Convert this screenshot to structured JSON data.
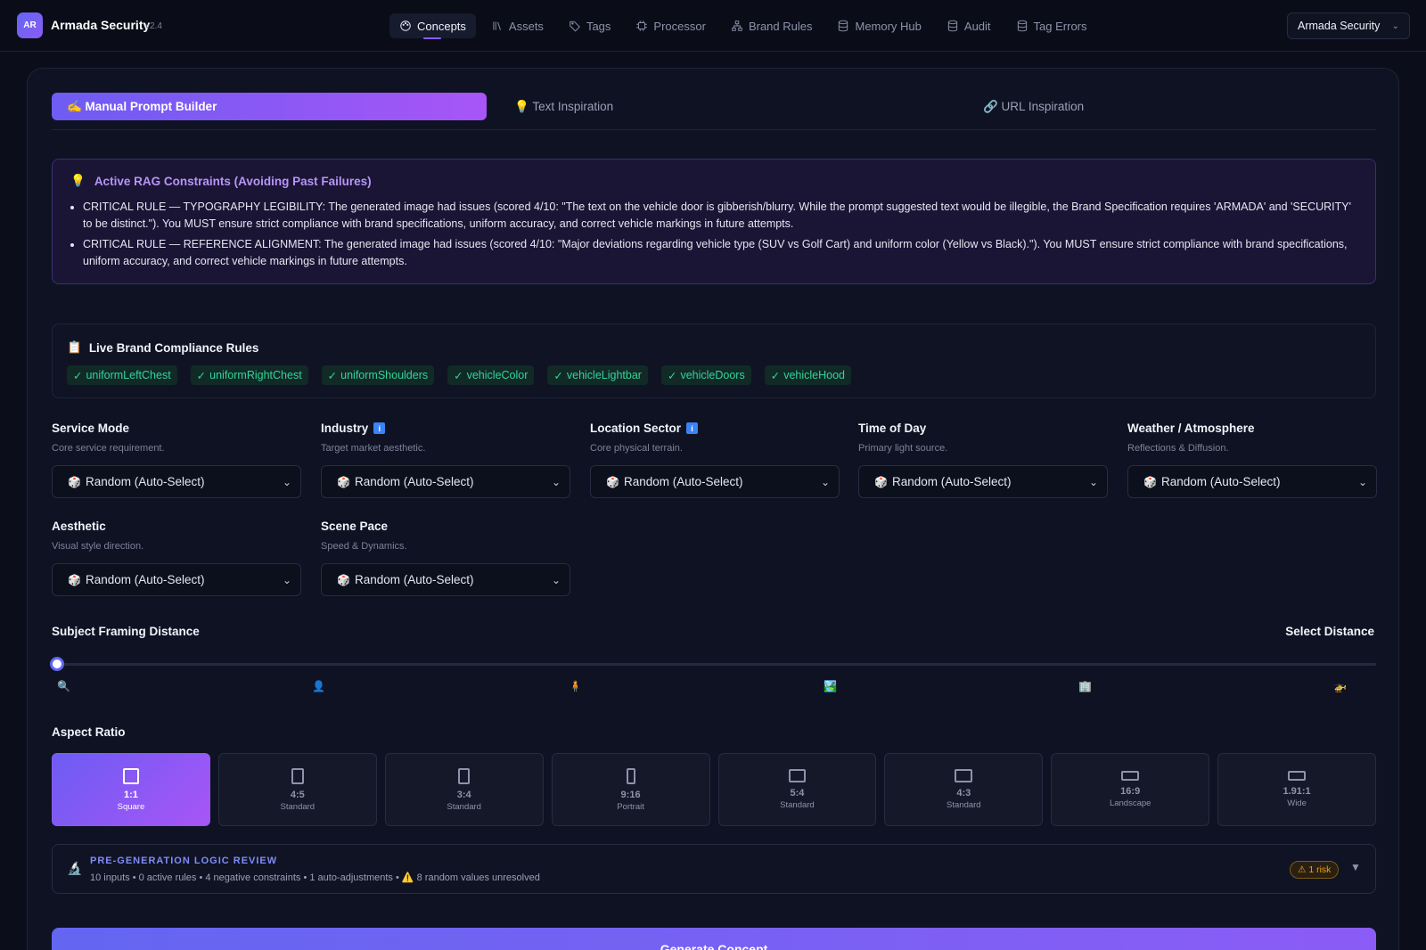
{
  "app": {
    "badge": "AR",
    "title": "Armada Security",
    "version": "v2.4"
  },
  "nav": [
    {
      "label": "Concepts",
      "icon": "palette-icon",
      "active": true
    },
    {
      "label": "Assets",
      "icon": "library-icon",
      "active": false
    },
    {
      "label": "Tags",
      "icon": "tag-icon",
      "active": false
    },
    {
      "label": "Processor",
      "icon": "cpu-icon",
      "active": false
    },
    {
      "label": "Brand Rules",
      "icon": "sitemap-icon",
      "active": false
    },
    {
      "label": "Memory Hub",
      "icon": "database-icon",
      "active": false
    },
    {
      "label": "Audit",
      "icon": "database-icon",
      "active": false
    },
    {
      "label": "Tag Errors",
      "icon": "database-icon",
      "active": false
    }
  ],
  "org_select": {
    "value": "Armada Security"
  },
  "mode_tabs": [
    {
      "label": "✍️ Manual Prompt Builder",
      "active": true
    },
    {
      "label": "💡 Text Inspiration",
      "active": false
    },
    {
      "label": "🔗 URL Inspiration",
      "active": false
    }
  ],
  "rag": {
    "title": "Active RAG Constraints (Avoiding Past Failures)",
    "rules": [
      "CRITICAL RULE — TYPOGRAPHY LEGIBILITY: The generated image had issues (scored 4/10: \"The text on the vehicle door is gibberish/blurry. While the prompt suggested text would be illegible, the Brand Specification requires 'ARMADA' and 'SECURITY' to be distinct.\"). You MUST ensure strict compliance with brand specifications, uniform accuracy, and correct vehicle markings in future attempts.",
      "CRITICAL RULE — REFERENCE ALIGNMENT: The generated image had issues (scored 4/10: \"Major deviations regarding vehicle type (SUV vs Golf Cart) and uniform color (Yellow vs Black).\"). You MUST ensure strict compliance with brand specifications, uniform accuracy, and correct vehicle markings in future attempts."
    ]
  },
  "compliance": {
    "title": "Live Brand Compliance Rules",
    "chips": [
      "uniformLeftChest",
      "uniformRightChest",
      "uniformShoulders",
      "vehicleColor",
      "vehicleLightbar",
      "vehicleDoors",
      "vehicleHood"
    ]
  },
  "fields": [
    {
      "label": "Service Mode",
      "sub": "Core service requirement.",
      "value": "Random (Auto-Select)",
      "info": false
    },
    {
      "label": "Industry",
      "sub": "Target market aesthetic.",
      "value": "Random (Auto-Select)",
      "info": true
    },
    {
      "label": "Location Sector",
      "sub": "Core physical terrain.",
      "value": "Random (Auto-Select)",
      "info": true
    },
    {
      "label": "Time of Day",
      "sub": "Primary light source.",
      "value": "Random (Auto-Select)",
      "info": false
    },
    {
      "label": "Weather / Atmosphere",
      "sub": "Reflections & Diffusion.",
      "value": "Random (Auto-Select)",
      "info": false
    },
    {
      "label": "Aesthetic",
      "sub": "Visual style direction.",
      "value": "Random (Auto-Select)",
      "info": false
    },
    {
      "label": "Scene Pace",
      "sub": "Speed & Dynamics.",
      "value": "Random (Auto-Select)",
      "info": false
    }
  ],
  "framing": {
    "label": "Subject Framing Distance",
    "right_label": "Select Distance",
    "value_fraction": 0,
    "stops": [
      "🔍",
      "👤",
      "🧍",
      "🏞️",
      "🏢",
      "🚁"
    ]
  },
  "aspect": {
    "label": "Aspect Ratio",
    "options": [
      {
        "ratio": "1:1",
        "sub": "Square",
        "active": true,
        "w": 1,
        "h": 1
      },
      {
        "ratio": "4:5",
        "sub": "Standard",
        "active": false,
        "w": 4,
        "h": 5
      },
      {
        "ratio": "3:4",
        "sub": "Standard",
        "active": false,
        "w": 3,
        "h": 4
      },
      {
        "ratio": "9:16",
        "sub": "Portrait",
        "active": false,
        "w": 9,
        "h": 16
      },
      {
        "ratio": "5:4",
        "sub": "Standard",
        "active": false,
        "w": 5,
        "h": 4
      },
      {
        "ratio": "4:3",
        "sub": "Standard",
        "active": false,
        "w": 4,
        "h": 3
      },
      {
        "ratio": "16:9",
        "sub": "Landscape",
        "active": false,
        "w": 16,
        "h": 9
      },
      {
        "ratio": "1.91:1",
        "sub": "Wide",
        "active": false,
        "w": 1.91,
        "h": 1
      }
    ]
  },
  "review": {
    "title": "PRE-GENERATION LOGIC REVIEW",
    "detail": "10 inputs • 0 active rules • 4 negative constraints • 1 auto-adjustments • ⚠️ 8 random values unresolved",
    "risk": "⚠ 1 risk"
  },
  "generate": {
    "label": "Generate Concept"
  },
  "colors": {
    "accent": "#8b5cf6",
    "accent2": "#6366f1",
    "success": "#34d399",
    "warning": "#f59e0b"
  }
}
